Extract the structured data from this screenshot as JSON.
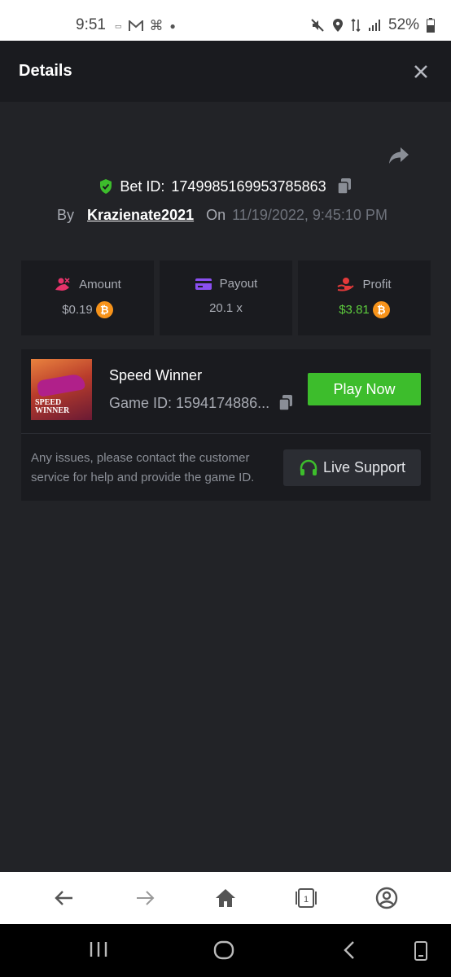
{
  "status_bar": {
    "time": "9:51",
    "battery": "52%",
    "icons": [
      "notification-icon",
      "gmail-icon",
      "command-icon",
      "dot-icon",
      "mute-icon",
      "location-icon",
      "data-icon",
      "signal-icon",
      "battery-icon"
    ]
  },
  "header": {
    "title": "Details"
  },
  "bet": {
    "bet_id_label": "Bet ID:",
    "bet_id": "1749985169953785863",
    "by_label": "By",
    "username": "Krazienate2021",
    "on_label": "On",
    "datetime": "11/19/2022, 9:45:10 PM"
  },
  "stats": {
    "amount_label": "Amount",
    "amount_value": "$0.19",
    "payout_label": "Payout",
    "payout_value": "20.1 x",
    "profit_label": "Profit",
    "profit_value": "$3.81"
  },
  "game": {
    "name": "Speed Winner",
    "game_id": "Game ID: 1594174886...",
    "thumb_text_1": "SPEED",
    "thumb_text_2": "WINNER",
    "play_label": "Play Now",
    "issues_text": "Any issues, please contact the customer service for help and provide the game ID.",
    "support_label": "Live Support"
  },
  "colors": {
    "background": "#222327",
    "card": "#1a1b1f",
    "accent_green": "#3dbd2c",
    "profit_green": "#5ece3e",
    "coin": "#f7931a"
  }
}
